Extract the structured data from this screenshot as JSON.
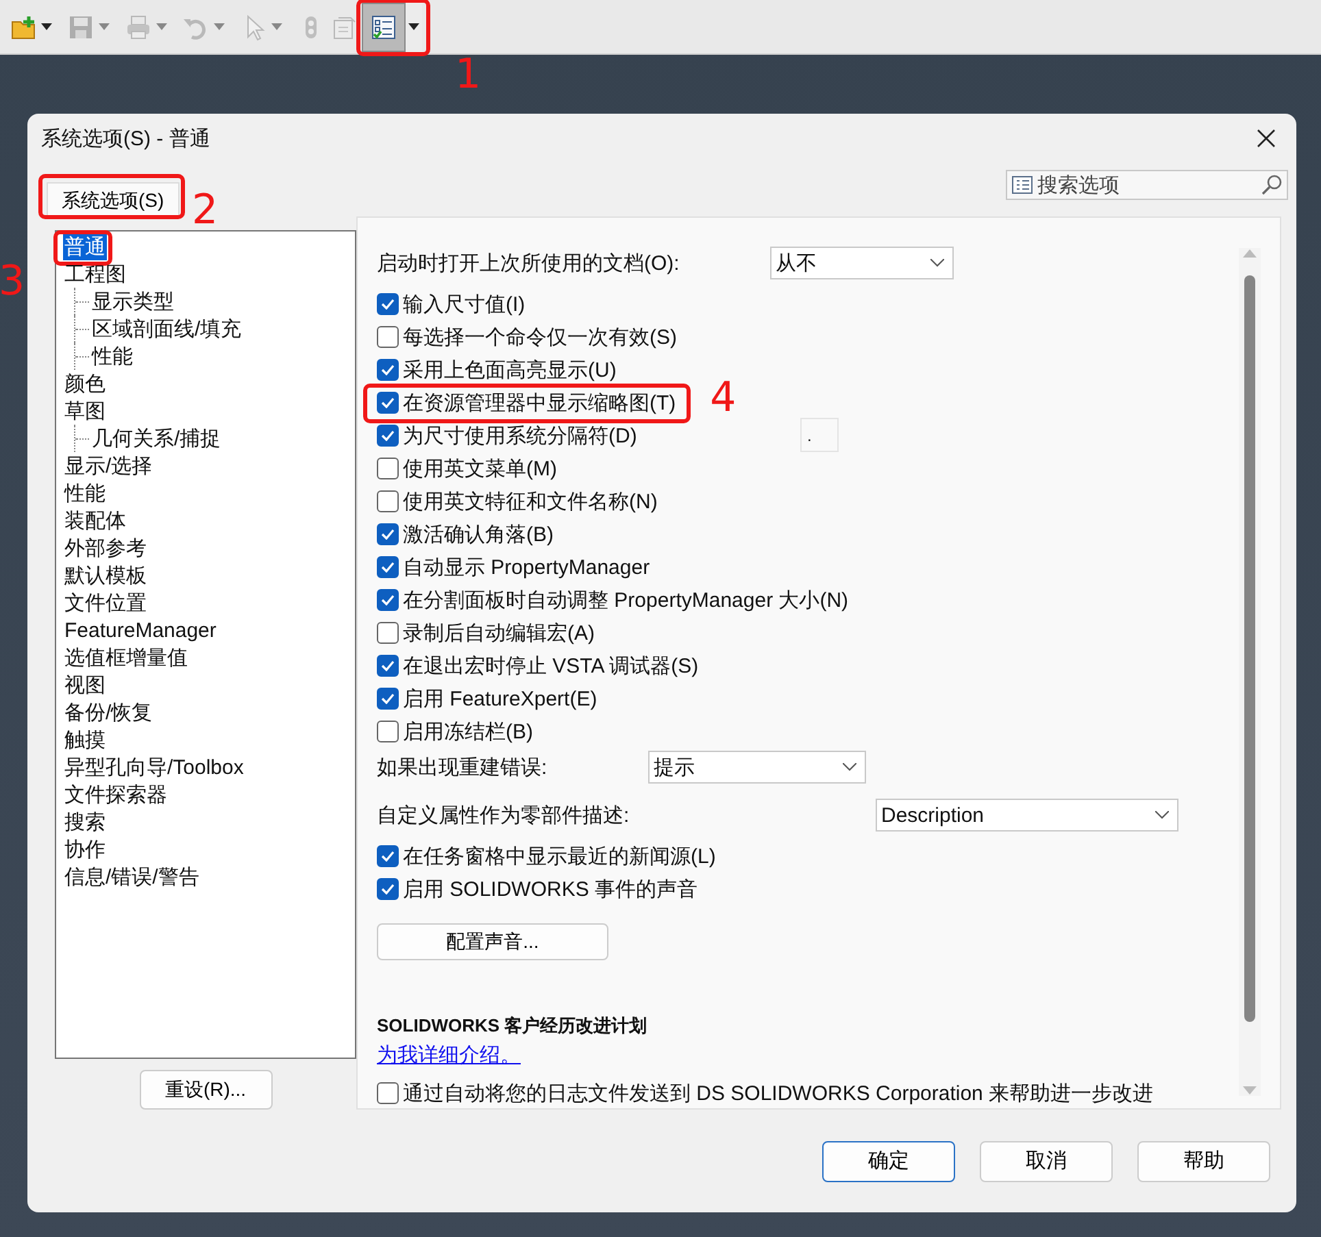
{
  "toolbar": {
    "items": [
      {
        "kind": "open",
        "dropdown": true,
        "disabled": false,
        "pressed": false
      },
      {
        "kind": "save",
        "dropdown": true,
        "disabled": true,
        "pressed": false
      },
      {
        "kind": "print",
        "dropdown": true,
        "disabled": true,
        "pressed": false
      },
      {
        "kind": "undo",
        "dropdown": true,
        "disabled": true,
        "pressed": false
      },
      {
        "kind": "select",
        "dropdown": true,
        "disabled": true,
        "pressed": false
      },
      {
        "kind": "rebuild",
        "dropdown": false,
        "disabled": true,
        "pressed": false
      },
      {
        "kind": "properties",
        "dropdown": false,
        "disabled": true,
        "pressed": false
      },
      {
        "kind": "options",
        "dropdown": true,
        "disabled": false,
        "pressed": true,
        "annotation": "1"
      }
    ]
  },
  "dialog": {
    "title": "系统选项(S) - 普通",
    "tab": {
      "label": "系统选项(S)",
      "annotation": "2"
    },
    "search": {
      "placeholder": "搜索选项"
    },
    "tree": [
      {
        "label": "普通",
        "selected": true,
        "annotation": "3"
      },
      {
        "label": "工程图",
        "selected": false,
        "children": [
          {
            "label": "显示类型",
            "selected": false
          },
          {
            "label": "区域剖面线/填充",
            "selected": false
          },
          {
            "label": "性能",
            "selected": false
          }
        ]
      },
      {
        "label": "颜色",
        "selected": false
      },
      {
        "label": "草图",
        "selected": false,
        "children": [
          {
            "label": "几何关系/捕捉",
            "selected": false
          }
        ]
      },
      {
        "label": "显示/选择",
        "selected": false
      },
      {
        "label": "性能",
        "selected": false
      },
      {
        "label": "装配体",
        "selected": false
      },
      {
        "label": "外部参考",
        "selected": false
      },
      {
        "label": "默认模板",
        "selected": false
      },
      {
        "label": "文件位置",
        "selected": false
      },
      {
        "label": "FeatureManager",
        "selected": false
      },
      {
        "label": "选值框增量值",
        "selected": false
      },
      {
        "label": "视图",
        "selected": false
      },
      {
        "label": "备份/恢复",
        "selected": false
      },
      {
        "label": "触摸",
        "selected": false
      },
      {
        "label": "异型孔向导/Toolbox",
        "selected": false
      },
      {
        "label": "文件探索器",
        "selected": false
      },
      {
        "label": "搜索",
        "selected": false
      },
      {
        "label": "协作",
        "selected": false
      },
      {
        "label": "信息/错误/警告",
        "selected": false
      }
    ],
    "reset_button": "重设(R)...",
    "options": [
      {
        "kind": "dropdown",
        "label": "启动时打开上次所使用的文档(O):",
        "value": "从不"
      },
      {
        "kind": "checkbox",
        "label": "输入尺寸值(I)",
        "checked": true
      },
      {
        "kind": "checkbox",
        "label": "每选择一个命令仅一次有效(S)",
        "checked": false
      },
      {
        "kind": "checkbox",
        "label": "采用上色面高亮显示(U)",
        "checked": true
      },
      {
        "kind": "checkbox",
        "label": "在资源管理器中显示缩略图(T)",
        "checked": true,
        "annotation": "4"
      },
      {
        "kind": "checkbox",
        "label": "为尺寸使用系统分隔符(D)",
        "checked": true,
        "field": "."
      },
      {
        "kind": "checkbox",
        "label": "使用英文菜单(M)",
        "checked": false
      },
      {
        "kind": "checkbox",
        "label": "使用英文特征和文件名称(N)",
        "checked": false
      },
      {
        "kind": "checkbox",
        "label": "激活确认角落(B)",
        "checked": true
      },
      {
        "kind": "checkbox",
        "label": "自动显示 PropertyManager",
        "checked": true
      },
      {
        "kind": "checkbox",
        "label": "在分割面板时自动调整 PropertyManager 大小(N)",
        "checked": true
      },
      {
        "kind": "checkbox",
        "label": "录制后自动编辑宏(A)",
        "checked": false
      },
      {
        "kind": "checkbox",
        "label": "在退出宏时停止 VSTA 调试器(S)",
        "checked": true
      },
      {
        "kind": "checkbox",
        "label": "启用 FeatureXpert(E)",
        "checked": true
      },
      {
        "kind": "checkbox",
        "label": "启用冻结栏(B)",
        "checked": false
      },
      {
        "kind": "dropdown",
        "label": "如果出现重建错误:",
        "value": "提示"
      },
      {
        "kind": "dropdown",
        "label": "自定义属性作为零部件描述:",
        "value": "Description"
      },
      {
        "kind": "checkbox",
        "label": "在任务窗格中显示最近的新闻源(L)",
        "checked": true
      },
      {
        "kind": "checkbox",
        "label": "启用 SOLIDWORKS 事件的声音",
        "checked": true
      },
      {
        "kind": "button",
        "label": "配置声音..."
      },
      {
        "kind": "heading",
        "label": "SOLIDWORKS 客户经历改进计划"
      },
      {
        "kind": "link",
        "label": "为我详细介绍。"
      },
      {
        "kind": "checkbox",
        "label": "通过自动将您的日志文件发送到 DS SOLIDWORKS Corporation 来帮助进一步改进",
        "checked": false
      }
    ],
    "buttons": [
      {
        "label": "确定",
        "default": true
      },
      {
        "label": "取消",
        "default": false
      },
      {
        "label": "帮助",
        "default": false
      }
    ]
  }
}
